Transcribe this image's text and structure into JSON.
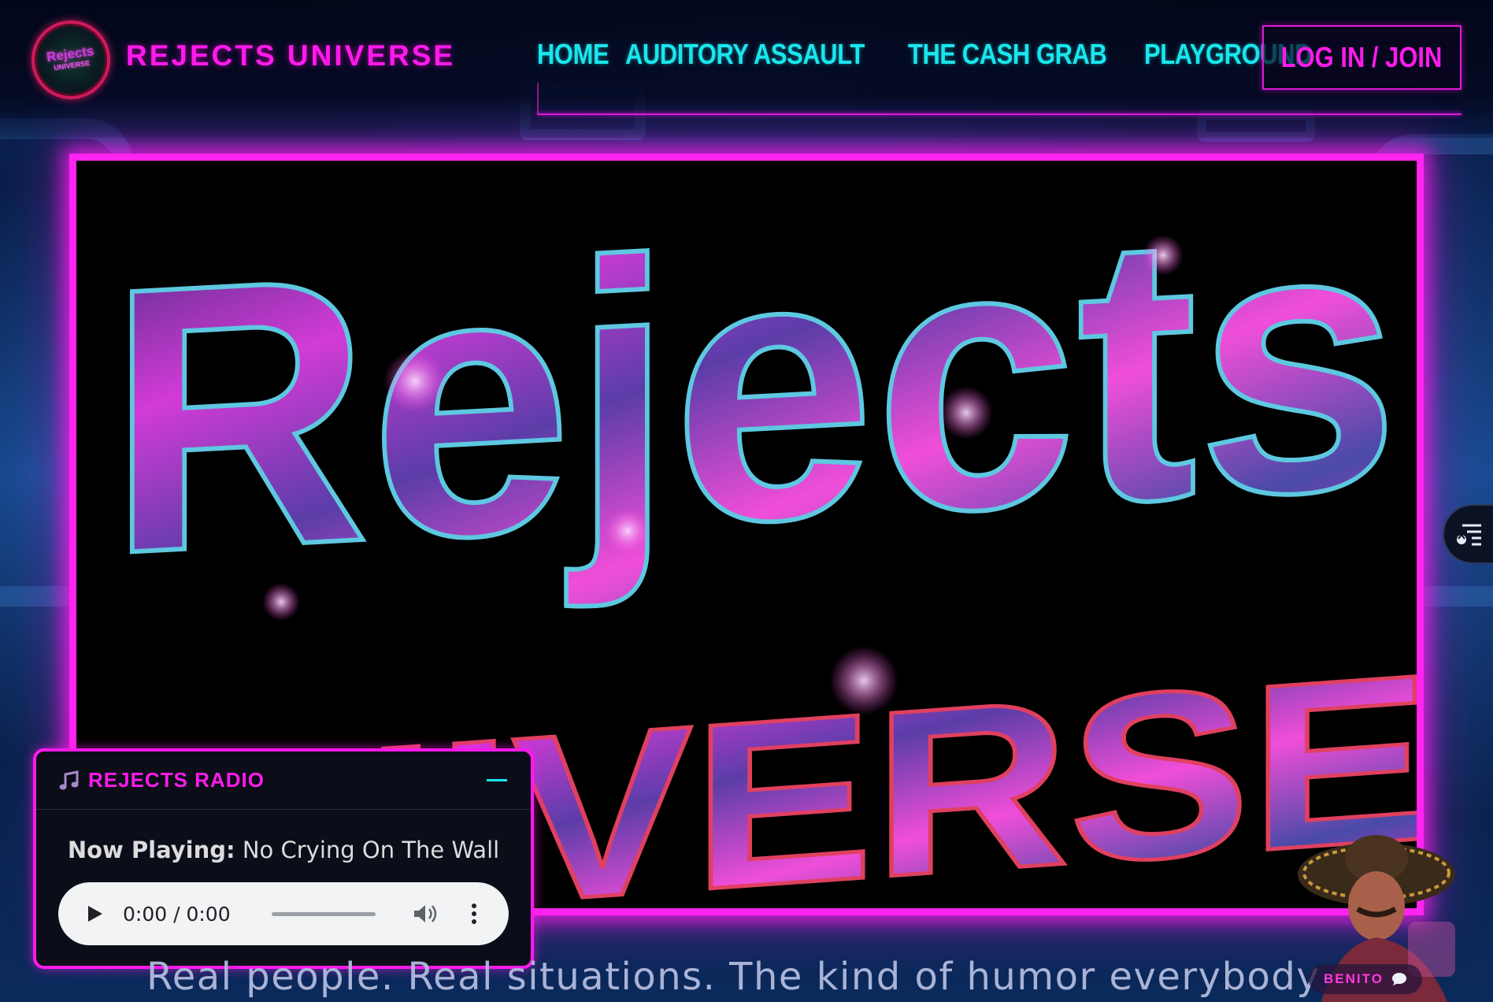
{
  "brand": {
    "name": "REJECTS UNIVERSE",
    "logo_text_top": "Rejects",
    "logo_text_bottom": "UNIVERSE"
  },
  "nav": {
    "items": [
      "HOME",
      "AUDITORY ASSAULT",
      "THE CASH GRAB",
      "PLAYGROUND"
    ],
    "login_label": "LOG IN / JOIN"
  },
  "hero": {
    "title_line1": "Rejects",
    "title_line2": "UNIVERSE"
  },
  "radio": {
    "title": "REJECTS RADIO",
    "now_playing_label": "Now Playing:",
    "track": "No Crying On The Wall",
    "time": "0:00 / 0:00"
  },
  "tagline": "Real people. Real situations. The kind of humor everybody",
  "chat": {
    "label": "BENITO"
  },
  "colors": {
    "accent_pink": "#ff1aeb",
    "accent_cyan": "#19e6ee",
    "background": "#061436"
  },
  "icons": [
    "music-note-icon",
    "minimize-icon",
    "play-icon",
    "volume-icon",
    "more-vert-icon",
    "menu-widget-icon",
    "chat-bubble-icon"
  ]
}
